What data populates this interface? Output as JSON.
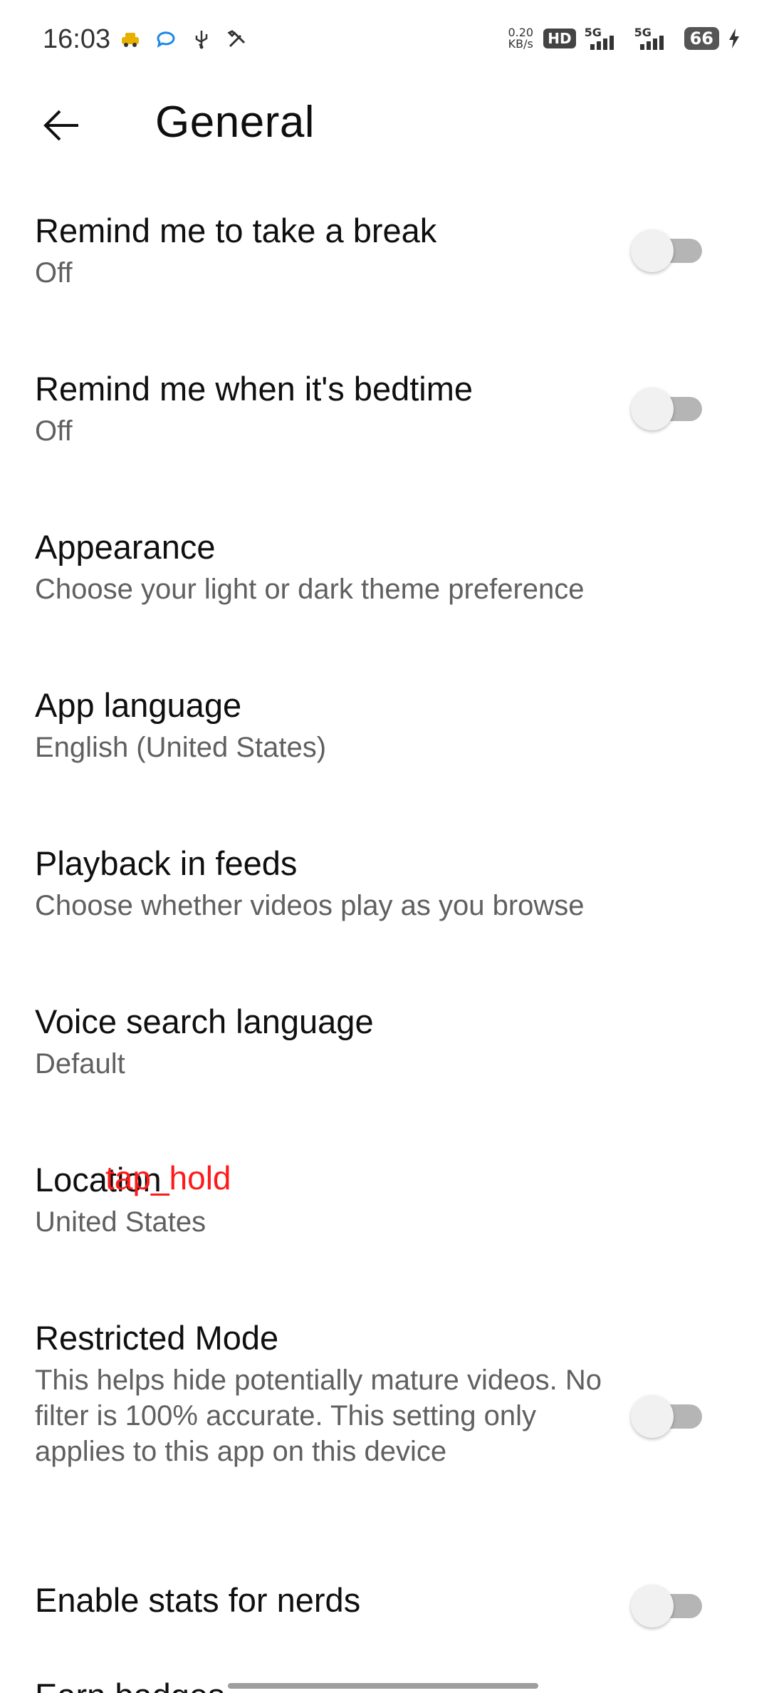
{
  "status_bar": {
    "time": "16:03",
    "left_icons": [
      "taxi-icon",
      "chat-bubble-icon",
      "usb-icon",
      "tools-icon"
    ],
    "net_speed_value": "0.20",
    "net_speed_unit": "KB/s",
    "hd_label": "HD",
    "sim1_label": "5G",
    "sim2_label": "5G",
    "battery_level": "66"
  },
  "header": {
    "title": "General"
  },
  "settings": [
    {
      "title": "Remind me to take a break",
      "subtitle": "Off",
      "toggle": false
    },
    {
      "title": "Remind me when it's bedtime",
      "subtitle": "Off",
      "toggle": false
    },
    {
      "title": "Appearance",
      "subtitle": "Choose your light or dark theme preference"
    },
    {
      "title": "App language",
      "subtitle": "English (United States)"
    },
    {
      "title": "Playback in feeds",
      "subtitle": "Choose whether videos play as you browse"
    },
    {
      "title": "Voice search language",
      "subtitle": "Default"
    },
    {
      "title": "Location",
      "subtitle": "United States"
    },
    {
      "title": "Restricted Mode",
      "subtitle": "This helps hide potentially mature videos. No filter is 100% accurate. This setting only applies to this app on this device",
      "toggle": false
    },
    {
      "title": "Enable stats for nerds",
      "toggle": false
    },
    {
      "title": "Earn badges"
    }
  ],
  "overlay": {
    "action_label": "tap_hold",
    "color": "#ff1a1a"
  }
}
